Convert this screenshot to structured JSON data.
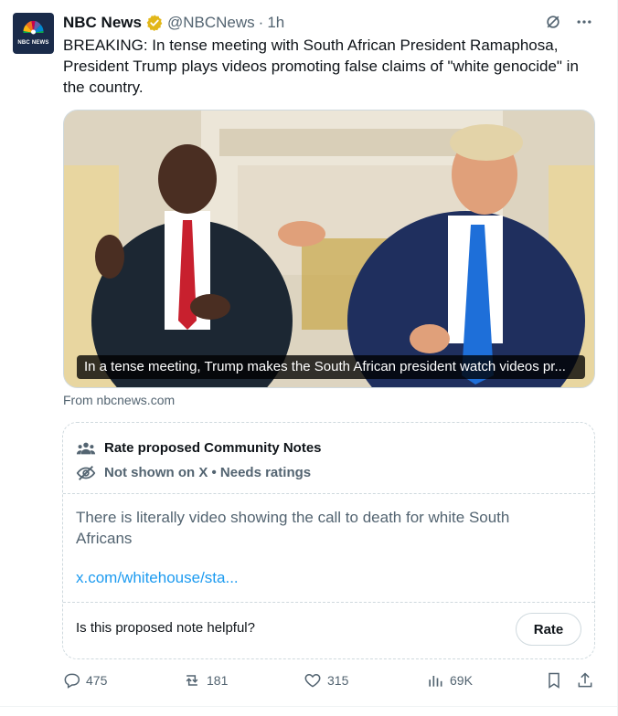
{
  "tweet": {
    "author_name": "NBC News",
    "handle": "@NBCNews",
    "separator": "·",
    "time": "1h",
    "avatar_label": "NBC NEWS",
    "text": "BREAKING: In tense meeting with South African President Ramaphosa, President Trump plays videos promoting false claims of \"white genocide\" in the country.",
    "media_caption": "In a tense meeting, Trump makes the South African president watch videos pr...",
    "source": "From nbcnews.com",
    "icons": {
      "verified": "verified-badge-icon",
      "grok": "grok-icon",
      "more": "more-icon"
    }
  },
  "community_note": {
    "title": "Rate proposed Community Notes",
    "status": "Not shown on X • Needs ratings",
    "text": "There is literally video showing the call to death for white South Africans",
    "link": "x.com/whitehouse/sta...",
    "question": "Is this proposed note helpful?",
    "rate_label": "Rate"
  },
  "actions": {
    "replies": "475",
    "reposts": "181",
    "likes": "315",
    "views": "69K"
  },
  "colors": {
    "text_primary": "#0f1419",
    "text_secondary": "#536471",
    "link": "#1d9bf0",
    "border": "#cfd9de",
    "verified_gold": "#e2b719"
  }
}
